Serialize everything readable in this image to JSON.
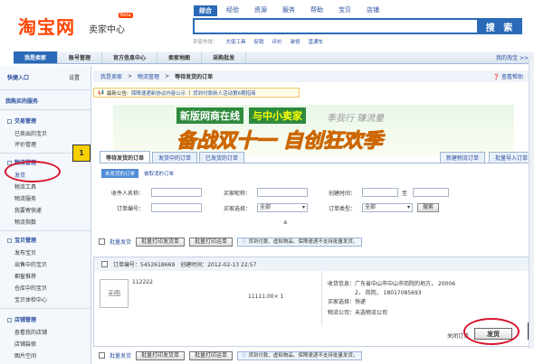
{
  "logo": {
    "brand": "淘宝网",
    "sub": "卖家中心",
    "beta": "Beta"
  },
  "search_tabs": [
    "综合",
    "经验",
    "资源",
    "服务",
    "帮助",
    "宝贝",
    "店铺"
  ],
  "search": {
    "button": "搜 索",
    "hot_label": "卖家热搜：",
    "hot": [
      "大促工具",
      "促销",
      "评价",
      "装修",
      "直通车"
    ]
  },
  "nav": {
    "items": [
      "我是卖家",
      "账号管理",
      "官方信息中心",
      "卖家地图",
      "采购批发"
    ],
    "right": "我的淘宝 >>"
  },
  "sidebar": {
    "quick": "快捷入口",
    "settings": "设置",
    "bought_services": "我购买的服务",
    "sections": [
      {
        "title": "交易管理",
        "items": [
          "已卖出的宝贝",
          "评价管理"
        ]
      },
      {
        "title": "物流管理",
        "items": [
          "发货",
          "物流工具",
          "物流服务",
          "我要寄快递",
          "物流指数"
        ]
      },
      {
        "title": "宝贝管理",
        "items": [
          "发布宝贝",
          "出售中的宝贝",
          "橱窗推荐",
          "仓库中的宝贝",
          "宝贝体检中心"
        ]
      },
      {
        "title": "店铺管理",
        "items": [
          "查看我的店铺",
          "店铺装修",
          "图片空间"
        ]
      }
    ]
  },
  "breadcrumb": {
    "items": [
      "我是卖家",
      "物流管理"
    ],
    "current": "等待发货的订单",
    "help": "查看帮助"
  },
  "notice": {
    "label": "最新公告:",
    "text1": "保障速递新协议内容公示",
    "sep": "|",
    "text2": "货到付款新人活动第6期招商"
  },
  "banner": {
    "line1": "新版网商在线",
    "line2": "与中小卖家",
    "line3": "备战双十一",
    "line4": "自创狂欢季",
    "slogan": "季我行 赚流量"
  },
  "tabs": {
    "items": [
      "等待发货的订单",
      "发货中的订单",
      "已发货的订单"
    ],
    "right": [
      "新建物流订单",
      "批量导入订单"
    ]
  },
  "subtabs": [
    "未发货的订单",
    "被取消的订单"
  ],
  "filter": {
    "receiver": "收件人名称：",
    "buyer": "买家昵称：",
    "created": "创建时间：",
    "to": "至",
    "order_no": "订单编号：",
    "buyer_select": "买家选择：",
    "all": "全部",
    "order_type": "订单类型：",
    "search": "搜索"
  },
  "bulk": {
    "label": "批量发货",
    "print_ship": "批量打印发货单",
    "print_express": "批量打印运单",
    "tip": "货到付款、虚拟物品、保障速递不支持批量发货。"
  },
  "order": {
    "no_label": "订单编号：",
    "no": "5452618669",
    "created_label": "创建时间：",
    "created": "2012-02-13 22:57",
    "no_image": "无图",
    "item_id": "112222",
    "price": "11111.00× 1",
    "recv_label": "收货信息：",
    "recv1": "广东省中山市中山市岗院的地方， 20006",
    "recv2": "2， 岗院， 18017085693",
    "buyer_select_label": "买家选择：",
    "buyer_select": "快递",
    "logistics_label": "物流公司：",
    "logistics": "未选物流公司",
    "close": "关闭订单",
    "ship": "发货"
  },
  "badges": {
    "one": "1",
    "two": "2"
  }
}
